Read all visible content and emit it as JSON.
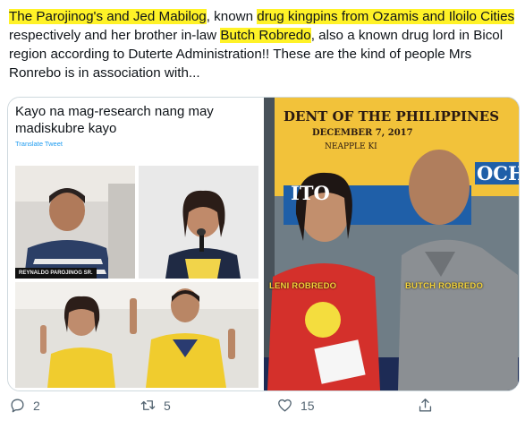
{
  "post": {
    "segments": [
      {
        "text": "The Parojinog's and Jed Mabilog",
        "highlight": true
      },
      {
        "text": ", known ",
        "highlight": false
      },
      {
        "text": "drug kingpins from Ozamis and Iloilo Cities",
        "highlight": true
      },
      {
        "text": " respectively and her brother in-law ",
        "highlight": false
      },
      {
        "text": "Butch Robredo",
        "highlight": true
      },
      {
        "text": ", also a known drug lord in Bicol region according to Duterte Administration!! These are the kind of people Mrs Ronrebo is in association with...",
        "highlight": false
      }
    ]
  },
  "quoted": {
    "text": "Kayo na mag-research nang may madiskubre kayo",
    "translate_label": "Translate Tweet",
    "photo_caption": "REYNALDO PAROJINOG SR."
  },
  "right_photo": {
    "banner_line1": "DENT OF THE PHILIPPINES",
    "banner_line2": "DECEMBER 7, 2017",
    "banner_line3": "NEAPPLE KI",
    "sign_left": "ITO",
    "sign_right": "OCH",
    "label_left": "LENI ROBREDO",
    "label_right": "BUTCH ROBREDO"
  },
  "actions": {
    "replies": "2",
    "retweets": "5",
    "likes": "15"
  },
  "colors": {
    "highlight": "#fff227",
    "action_gray": "#536471",
    "link_blue": "#1d9bf0",
    "label_yellow": "#f3d23a"
  }
}
